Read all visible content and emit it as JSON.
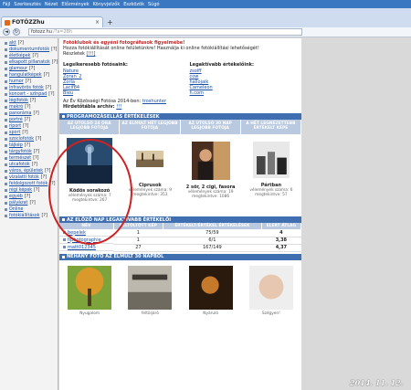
{
  "browser": {
    "menu": [
      "Fájl",
      "Szerkesztés",
      "Nézet",
      "Előzmények",
      "Könyvjelzők",
      "Eszközök",
      "Súgó"
    ],
    "tab_title": "FOTÓZZhu",
    "tab_close": "×",
    "new_tab": "+",
    "url_host": "fotozz.hu",
    "url_path": "/?a=28h",
    "back": "◄",
    "reload": "↻"
  },
  "sidebar": {
    "categories": [
      {
        "label": "akt",
        "count": "[?]"
      },
      {
        "label": "dokumentumfotók",
        "count": "[?]"
      },
      {
        "label": "életképek",
        "count": "[?]"
      },
      {
        "label": "elkapott pillanatok",
        "count": "[?]"
      },
      {
        "label": "glamour",
        "count": "[?]"
      },
      {
        "label": "hangulatképek",
        "count": "[?]"
      },
      {
        "label": "humor",
        "count": "[?]"
      },
      {
        "label": "infravörös fotók",
        "count": "[?]"
      },
      {
        "label": "koncert - színpad",
        "count": "[?]"
      },
      {
        "label": "légifotók",
        "count": "[?]"
      },
      {
        "label": "makró",
        "count": "[?]"
      },
      {
        "label": "panoráma",
        "count": "[?]"
      },
      {
        "label": "portré",
        "count": "[?]"
      },
      {
        "label": "riport",
        "count": "[?]"
      },
      {
        "label": "sport",
        "count": "[?]"
      },
      {
        "label": "szociofotók",
        "count": "[?]"
      },
      {
        "label": "tájkép",
        "count": "[?]"
      },
      {
        "label": "tárgyfotók",
        "count": "[?]"
      },
      {
        "label": "természet",
        "count": "[?]"
      },
      {
        "label": "utcafotók",
        "count": "[?]"
      },
      {
        "label": "város, épületek",
        "count": "[?]"
      },
      {
        "label": "vízalatti fotók",
        "count": "[?]"
      },
      {
        "label": "feldolgozott fotók",
        "count": "[?]"
      },
      {
        "label": "régi képek",
        "count": "[?]"
      },
      {
        "label": "egyéb",
        "count": "[?]"
      },
      {
        "label": "pályázat",
        "count": "[?]"
      },
      {
        "label": "Online",
        "count": ""
      },
      {
        "label": "fotókiállítások",
        "count": "[?]"
      }
    ]
  },
  "intro": {
    "alert": "Fotóklubok és egyéni fotográfusok figyelmébe!",
    "line1": "Hozza fotókiállítását online felületünkre! Használja ki online fotókiállítási lehetőségét!",
    "details_label": "Részletek",
    "details_link": "[!!!]"
  },
  "columns": {
    "left_title": "Legsikeresebb fotósaink:",
    "left_items": [
      "Nature",
      "Zoran_2",
      "Zorla",
      "Lacif84",
      "Bleu"
    ],
    "right_title": "Legaktívabb értékelőink:",
    "right_items": [
      "zsolff",
      "cow",
      "hallojaik",
      "Cameleon",
      "h.com"
    ]
  },
  "extra": {
    "line1": "Az Év Közösségi Fotósa 2014-ben:",
    "line1_link": "troshunter",
    "line2": "Hirdetőtábla archív:",
    "line2_link": "!!!"
  },
  "best": {
    "heading": "PROGRAMOZÁSELLÁS ÉRTÉKELÉSEK",
    "col_heads": [
      "AZ UTOLSÓ 24 ÓRA LEGJOBB FOTÓJA",
      "AZ ELMÚLT HÉT LEGJOBB FOTÓJA",
      "AZ UTOLSÓ 30 NAP LEGJOBB FOTÓJA",
      "A HÉT LEGNÉZETTEBB ÉRTÉKELT KÉPE"
    ],
    "cards": [
      {
        "title": "Ködös sorakozó",
        "meta1": "vélemények száma: 7",
        "meta2": "megtekintve: 267"
      },
      {
        "title": "Ciprusok",
        "meta1": "vélemények száma: 9",
        "meta2": "megtekintve: 353"
      },
      {
        "title": "2 sör, 2 cigi, fasora",
        "meta1": "vélemények száma: 19",
        "meta2": "megtekintve: 1086"
      },
      {
        "title": "Pártban",
        "meta1": "vélemények száma: 6",
        "meta2": "megtekintve: 57"
      }
    ]
  },
  "raters": {
    "heading": "AZ ELŐZŐ NAP LEGAKTÍVABB ÉRTÉKELŐI",
    "headers": [
      "NÉV",
      "FELTÖLTÖTT KÉP",
      "ÉRTÉKELT/ÉRTÉKEL ÉRTÉKELÉSEK",
      "ELERT ÁTLAG"
    ],
    "rows": [
      {
        "name": "bepelek",
        "uploaded": "1",
        "rated": "75/59",
        "avg": "4"
      },
      {
        "name": "hphotographie",
        "uploaded": "1",
        "rated": "6/1",
        "avg": "3,38"
      },
      {
        "name": "matt012345",
        "uploaded": "27",
        "rated": "167/149",
        "avg": "4,37"
      }
    ]
  },
  "recent": {
    "heading": "NÉHÁNY FOTÓ AZ ELMÚLT 30 NAPBÓL",
    "items": [
      "Nyugalom",
      "feltöljáró",
      "Nyáruló",
      "Szégyen!"
    ]
  },
  "stamp": "2014. 11. 12."
}
